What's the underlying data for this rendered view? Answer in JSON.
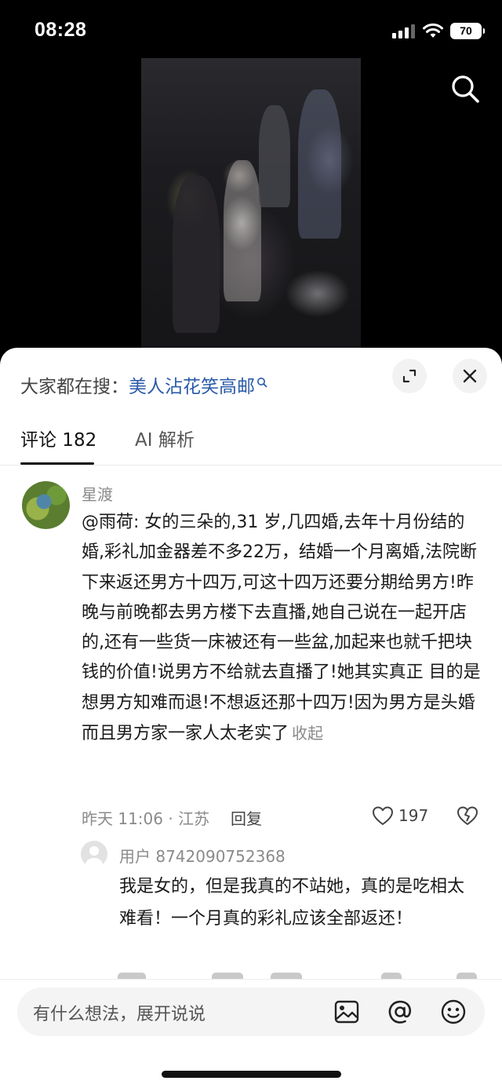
{
  "status_bar": {
    "time": "08:28",
    "battery": "70"
  },
  "sheet": {
    "trending_prefix": "大家都在搜：",
    "trending_keyword": "美人沾花笑高邮",
    "tabs": [
      {
        "label": "评论 182"
      },
      {
        "label": "AI 解析"
      }
    ]
  },
  "comment": {
    "author": "星渡",
    "text": "@雨荷: 女的三朵的,31 岁,几四婚,去年十月份结的婚,彩礼加金器差不多22万，结婚一个月离婚,法院断下来返还男方十四万,可这十四万还要分期给男方!昨晚与前晚都去男方楼下去直播,她自己说在一起开店的,还有一些货一床被还有一些盆,加起来也就千把块钱的价值!说男方不给就去直播了!她其实真正 目的是想男方知难而退!不想返还那十四万!因为男方是头婚而且男方家一家人太老实了",
    "collapse_label": "收起",
    "meta": "昨天 11:06 · 江苏",
    "reply_label": "回复",
    "likes": "197"
  },
  "reply": {
    "author": "用户 8742090752368",
    "text": "我是女的，但是我真的不站她，真的是吃相太难看！一个月真的彩礼应该全部返还！"
  },
  "input": {
    "placeholder": "有什么想法，展开说说"
  },
  "icons": [
    "signal-icon",
    "wifi-icon",
    "search-icon",
    "expand-icon",
    "close-icon",
    "heart-icon",
    "broken-heart-icon",
    "image-icon",
    "at-icon",
    "emoji-icon"
  ],
  "colors": {
    "keyword_blue": "#2a5aa8",
    "muted_gray": "#8a8a8a",
    "sheet_bg": "#ffffff",
    "page_bg": "#000000"
  }
}
